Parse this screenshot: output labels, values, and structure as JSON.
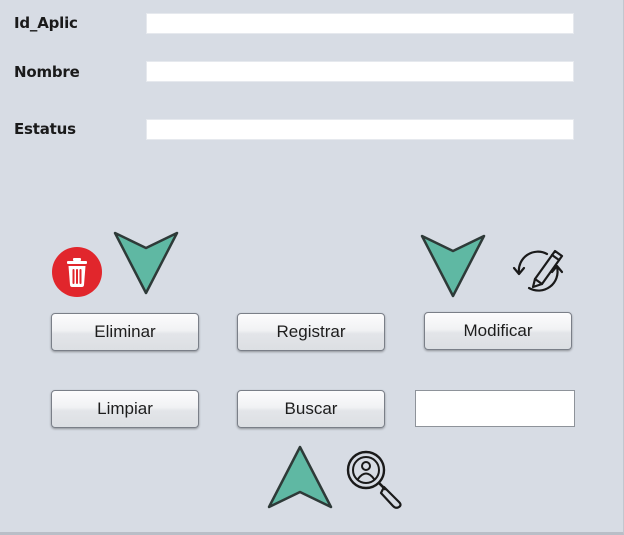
{
  "form": {
    "fields": [
      {
        "label": "Id_Aplic",
        "value": ""
      },
      {
        "label": "Nombre",
        "value": ""
      },
      {
        "label": "Estatus",
        "value": ""
      }
    ],
    "search_value": ""
  },
  "buttons": {
    "eliminar": "Eliminar",
    "registrar": "Registrar",
    "modificar": "Modificar",
    "limpiar": "Limpiar",
    "buscar": "Buscar"
  },
  "icons": {
    "delete": "trash-icon",
    "edit": "edit-sync-icon",
    "search": "user-search-icon",
    "arrow_down": "arrow-down-icon",
    "arrow_up": "arrow-up-icon"
  },
  "colors": {
    "panel_background": "#d7dce4",
    "arrow_fill": "#5fb8a3",
    "trash_circle": "#e1262c"
  }
}
